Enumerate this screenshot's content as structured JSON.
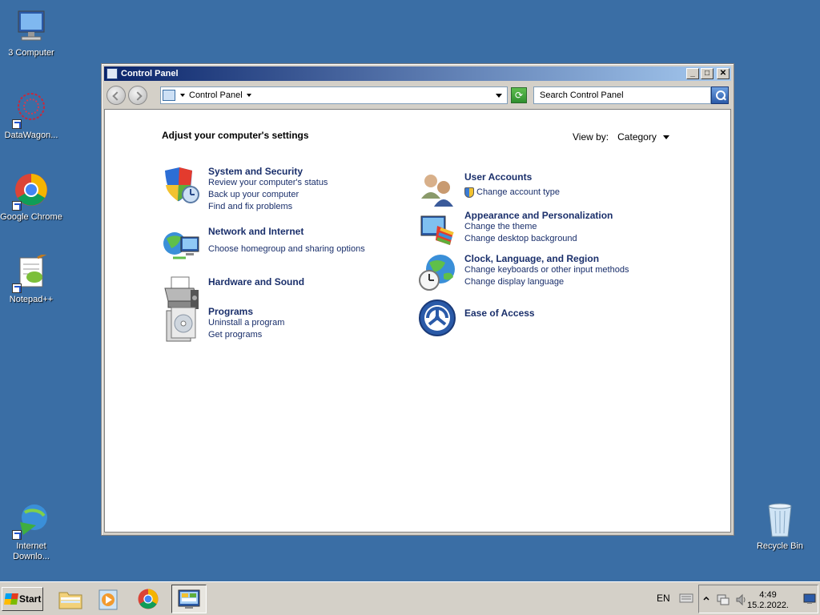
{
  "desktop": {
    "icons": [
      {
        "label": "3 Computer"
      },
      {
        "label": "DataWagon..."
      },
      {
        "label": "Google Chrome"
      },
      {
        "label": "Notepad++"
      },
      {
        "label": "Internet Downlo..."
      },
      {
        "label": "Recycle Bin"
      }
    ]
  },
  "window": {
    "title": "Control Panel",
    "controls": {
      "minimize": "_",
      "maximize": "□",
      "close": "✕"
    },
    "address": {
      "crumb": "Control Panel"
    },
    "search": {
      "placeholder": "Search Control Panel"
    },
    "heading": "Adjust your computer's settings",
    "view_by": {
      "label": "View by:",
      "value": "Category"
    },
    "categories_left": [
      {
        "title": "System and Security",
        "icon": "shield-icon",
        "links": [
          "Review your computer's status",
          "Back up your computer",
          "Find and fix problems"
        ]
      },
      {
        "title": "Network and Internet",
        "icon": "network-icon",
        "links": [
          "Choose homegroup and sharing options"
        ]
      },
      {
        "title": "Hardware and Sound",
        "icon": "printer-icon",
        "links": []
      },
      {
        "title": "Programs",
        "icon": "programs-icon",
        "links": [
          "Uninstall a program",
          "Get programs"
        ]
      }
    ],
    "categories_right": [
      {
        "title": "User Accounts",
        "icon": "users-icon",
        "links": [
          "Change account type"
        ]
      },
      {
        "title": "Appearance and Personalization",
        "icon": "appearance-icon",
        "links": [
          "Change the theme",
          "Change desktop background"
        ]
      },
      {
        "title": "Clock, Language, and Region",
        "icon": "clock-globe-icon",
        "links": [
          "Change keyboards or other input methods",
          "Change display language"
        ]
      },
      {
        "title": "Ease of Access",
        "icon": "ease-of-access-icon",
        "links": []
      }
    ]
  },
  "taskbar": {
    "start_label": "Start",
    "language": "EN",
    "time": "4:49",
    "date": "15.2.2022."
  }
}
